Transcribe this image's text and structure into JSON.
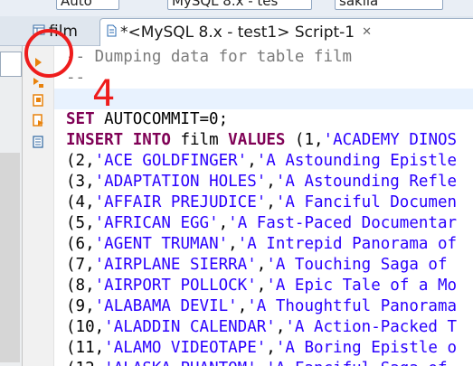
{
  "top_toolbar": {
    "combo1": "Auto",
    "combo2": "MySQL 8.x - tes",
    "combo3": "sakila"
  },
  "tabs": [
    {
      "label": "film",
      "active": false
    },
    {
      "label": "*<MySQL 8.x - test1> Script-1",
      "active": true,
      "close": "✕"
    }
  ],
  "editor": {
    "lines": [
      {
        "type": "comment",
        "text": "-- Dumping data for table film"
      },
      {
        "type": "comment",
        "text": "--"
      },
      {
        "type": "blank",
        "text": ""
      },
      {
        "type": "set",
        "kw": "SET",
        "rest": " AUTOCOMMIT=0;"
      },
      {
        "type": "insert",
        "kw1": "INSERT",
        "kw2": "INTO",
        "table": "film",
        "kw3": "VALUES",
        "rest": " (1,",
        "str": "'ACADEMY DINOS"
      },
      {
        "type": "row",
        "n": "2",
        "title": "'ACE GOLDFINGER'",
        "desc": "'A Astounding Epistle"
      },
      {
        "type": "row",
        "n": "3",
        "title": "'ADAPTATION HOLES'",
        "desc": "'A Astounding Refle"
      },
      {
        "type": "row",
        "n": "4",
        "title": "'AFFAIR PREJUDICE'",
        "desc": "'A Fanciful Documen"
      },
      {
        "type": "row",
        "n": "5",
        "title": "'AFRICAN EGG'",
        "desc": "'A Fast-Paced Documentar"
      },
      {
        "type": "row",
        "n": "6",
        "title": "'AGENT TRUMAN'",
        "desc": "'A Intrepid Panorama of"
      },
      {
        "type": "row",
        "n": "7",
        "title": "'AIRPLANE SIERRA'",
        "desc": "'A Touching Saga of"
      },
      {
        "type": "row",
        "n": "8",
        "title": "'AIRPORT POLLOCK'",
        "desc": "'A Epic Tale of a Mo"
      },
      {
        "type": "row",
        "n": "9",
        "title": "'ALABAMA DEVIL'",
        "desc": "'A Thoughtful Panorama"
      },
      {
        "type": "row",
        "n": "10",
        "title": "'ALADDIN CALENDAR'",
        "desc": "'A Action-Packed T"
      },
      {
        "type": "row",
        "n": "11",
        "title": "'ALAMO VIDEOTAPE'",
        "desc": "'A Boring Epistle o"
      },
      {
        "type": "row",
        "n": "12",
        "title": "'ALASKA PHANTOM'",
        "desc": "'A Fanciful Saga of"
      }
    ]
  },
  "gutter_icons": [
    "execute-statement-icon",
    "execute-script-icon",
    "execute-new-tab-icon",
    "explain-plan-icon",
    "load-script-icon"
  ],
  "annotation": {
    "text": "4",
    "color": "#ee1c1c"
  },
  "colors": {
    "keyword": "#7f0055",
    "string": "#2a00ff",
    "comment": "#7b7b7b",
    "current_line": "#e8f2fe",
    "annotation": "#ee1c1c"
  }
}
